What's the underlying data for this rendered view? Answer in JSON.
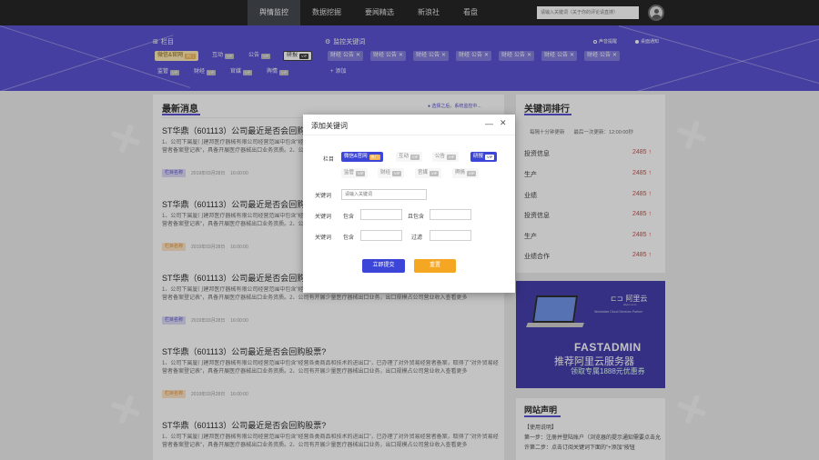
{
  "nav": {
    "tabs": [
      "舆情监控",
      "数据挖掘",
      "要闻精选",
      "新浪社",
      "看盘"
    ],
    "active_tab": 0,
    "search_placeholder": "请输入关键词（关于你的评论请直搜）"
  },
  "banner": {
    "column_title": "栏目",
    "keyword_title": "监控关键词",
    "column_chips": [
      {
        "label": "微信&官网",
        "badge": "热门",
        "style": "hl"
      },
      {
        "label": "互动",
        "badge": "VIP",
        "style": "plain"
      },
      {
        "label": "公告",
        "badge": "VIP",
        "style": "plain"
      },
      {
        "label": "研报",
        "badge": "VIP",
        "style": "dark"
      },
      {
        "label": "监管",
        "badge": "VIP",
        "style": "plain"
      },
      {
        "label": "财经",
        "badge": "VIP",
        "style": "plain"
      },
      {
        "label": "官媒",
        "badge": "VIP",
        "style": "plain"
      },
      {
        "label": "舆情",
        "badge": "VIP",
        "style": "plain"
      }
    ],
    "keyword_chips": [
      {
        "label": "财经",
        "sub": "公告"
      },
      {
        "label": "财经",
        "sub": "公告"
      },
      {
        "label": "财经",
        "sub": "公告"
      },
      {
        "label": "财经",
        "sub": "公告"
      },
      {
        "label": "财经",
        "sub": "公告"
      },
      {
        "label": "财经",
        "sub": "公告"
      },
      {
        "label": "财经",
        "sub": "公告"
      }
    ],
    "add_label": "添加",
    "radio1": "声音提醒",
    "radio2": "桌面通知"
  },
  "news": {
    "title": "最新消息",
    "hint": "选择之后，系统监控中...",
    "items": [
      {
        "title": "ST华鼎（601113）公司最近是否会回购股票?",
        "body": "1、公司下属厦门建邦医疗器械有限公司经营范围中包含\"经营各类商品和技术的进出口\"，已办理了对外贸易经营者备案，取得了\"对外贸易经营者备案登记表\"，具备开展医疗器械出口业务资质。2、公司有开展少量医疗器械出口业务，出口规模占公司营业收入查看更多",
        "tag": "栏目名称",
        "tag_style": "blue",
        "date": "2019年03月28日",
        "time": "16:00:00"
      },
      {
        "title": "ST华鼎（601113）公司最近是否会回购股票?",
        "body": "1、公司下属厦门建邦医疗器械有限公司经营范围中包含\"经营各类商品和技术的进出口\"，已办理了对外贸易经营者备案，取得了\"对外贸易经营者备案登记表\"，具备开展医疗器械出口业务资质。2、公司有开展少量医疗器械出口业务，出口规模占公司营业收入查看更多",
        "tag": "栏目名称",
        "tag_style": "orange",
        "date": "2019年03月28日",
        "time": "16:00:00"
      },
      {
        "title": "ST华鼎（601113）公司最近是否会回购股票?",
        "body": "1、公司下属厦门建邦医疗器械有限公司经营范围中包含\"经营各类商品和技术的进出口\"，已办理了对外贸易经营者备案，取得了\"对外贸易经营者备案登记表\"，具备开展医疗器械出口业务资质。2、公司有开展少量医疗器械出口业务，出口规模占公司营业收入查看更多",
        "tag": "栏目名称",
        "tag_style": "blue",
        "date": "2019年03月28日",
        "time": "16:00:00"
      },
      {
        "title": "ST华鼎（601113）公司最近是否会回购股票?",
        "body": "1、公司下属厦门建邦医疗器械有限公司经营范围中包含\"经营各类商品和技术的进出口\"，已办理了对外贸易经营者备案，取得了\"对外贸易经营者备案登记表\"，具备开展医疗器械出口业务资质。2、公司有开展少量医疗器械出口业务，出口规模占公司营业收入查看更多",
        "tag": "栏目名称",
        "tag_style": "orange",
        "date": "2019年03月28日",
        "time": "16:00:00"
      },
      {
        "title": "ST华鼎（601113）公司最近是否会回购股票?",
        "body": "1、公司下属厦门建邦医疗器械有限公司经营范围中包含\"经营各类商品和技术的进出口\"，已办理了对外贸易经营者备案，取得了\"对外贸易经营者备案登记表\"，具备开展医疗器械出口业务资质。2、公司有开展少量医疗器械出口业务，出口规模占公司营业收入查看更多",
        "tag": "栏目名称",
        "tag_style": "blue",
        "date": "2019年03月28日",
        "time": "16:00:00"
      }
    ]
  },
  "ranking": {
    "title": "关键词排行",
    "update_text": "每隔十分钟更新",
    "last_update": "最后一次更新：",
    "last_time": "12:00:00秒",
    "rows": [
      {
        "name": "投资信息",
        "value": "2485"
      },
      {
        "name": "生产",
        "value": "2485"
      },
      {
        "name": "业绩",
        "value": "2485"
      },
      {
        "name": "投资信息",
        "value": "2485"
      },
      {
        "name": "生产",
        "value": "2485"
      },
      {
        "name": "业绩合作",
        "value": "2485"
      }
    ]
  },
  "ad": {
    "brand": "阿里云",
    "brand_sub": "aliyun.com",
    "tagline": "Worldwide Cloud Services Partner",
    "title": "FASTADMIN",
    "subtitle": "推荐阿里云服务器",
    "cta": "领取专属1888元优惠券"
  },
  "notice": {
    "title": "网站声明",
    "lines": [
      "【使用说明】",
      "第一步：注册并登陆账户（浏览器的提示通知需要点击允许第二步：点击订阅关键词下面的\"+添加\"按钮"
    ]
  },
  "modal": {
    "title": "添加关键词",
    "column_label": "栏目",
    "chips_row1": [
      {
        "label": "微信&官网",
        "badge": "热门",
        "style": "sel"
      },
      {
        "label": "互动",
        "badge": "VIP",
        "style": "plain"
      },
      {
        "label": "公告",
        "badge": "VIP",
        "style": "plain"
      },
      {
        "label": "研报",
        "badge": "VIP",
        "style": "sel2"
      }
    ],
    "chips_row2": [
      {
        "label": "监管",
        "badge": "VIP"
      },
      {
        "label": "财经",
        "badge": "VIP"
      },
      {
        "label": "官媒",
        "badge": "VIP"
      },
      {
        "label": "舆情",
        "badge": "VIP"
      }
    ],
    "keyword_label": "关键词",
    "keyword_placeholder": "请输入关键词",
    "row2_label": "关键词",
    "include_label": "包含",
    "and_include_label": "且包含",
    "row3_label": "关键词",
    "include2_label": "包含",
    "filter_label": "过滤",
    "submit_label": "立即提交",
    "reset_label": "重置"
  },
  "colors": {
    "banner": "#5048d0",
    "nav": "#1a1a1a",
    "accent": "#3b46d8",
    "reset": "#f5a623",
    "rank_value": "#e53935"
  }
}
